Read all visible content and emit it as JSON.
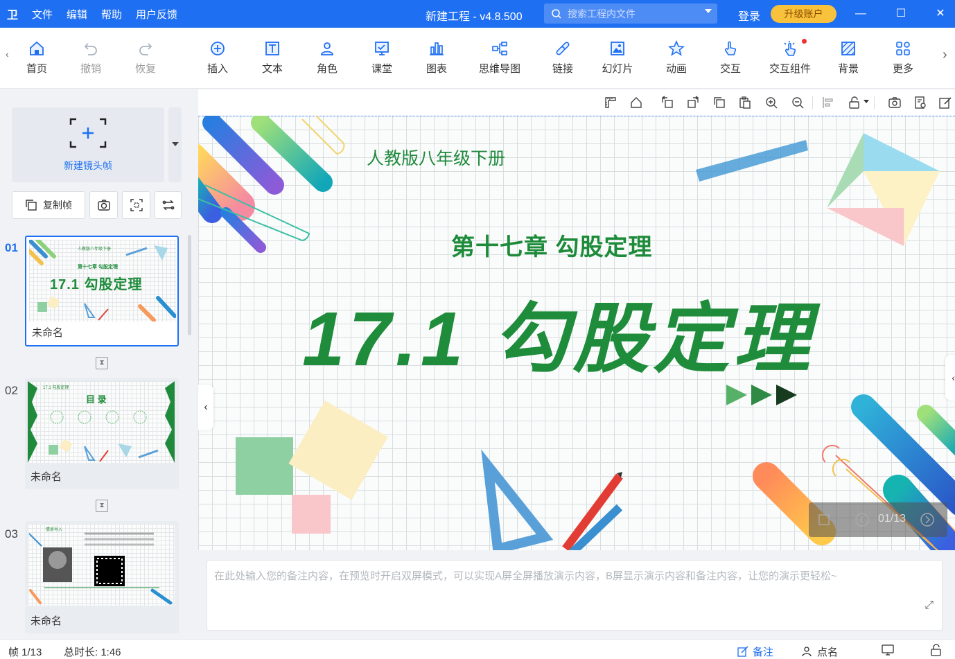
{
  "titlebar": {
    "logo": "卫",
    "menu": [
      "文件",
      "编辑",
      "帮助",
      "用户反馈"
    ],
    "window_title": "新建工程 - v4.8.500",
    "search_placeholder": "搜索工程内文件",
    "login": "登录",
    "upgrade": "升级账户",
    "minimize": "—",
    "maximize": "☐",
    "close": "✕"
  },
  "toolbar": {
    "left_arrow": "‹",
    "right_arrow": "›",
    "items": [
      {
        "label": "首页",
        "icon": "home-icon"
      },
      {
        "label": "撤销",
        "icon": "undo-icon"
      },
      {
        "label": "恢复",
        "icon": "redo-icon"
      },
      {
        "label": "插入",
        "icon": "plus-circle-icon"
      },
      {
        "label": "文本",
        "icon": "text-icon"
      },
      {
        "label": "角色",
        "icon": "person-icon"
      },
      {
        "label": "课堂",
        "icon": "classroom-icon"
      },
      {
        "label": "图表",
        "icon": "chart-icon"
      },
      {
        "label": "思维导图",
        "icon": "mindmap-icon"
      },
      {
        "label": "链接",
        "icon": "link-icon"
      },
      {
        "label": "幻灯片",
        "icon": "slide-icon"
      },
      {
        "label": "动画",
        "icon": "star-icon"
      },
      {
        "label": "交互",
        "icon": "hand-icon"
      },
      {
        "label": "交互组件",
        "icon": "interact-component-icon"
      },
      {
        "label": "背景",
        "icon": "background-icon"
      },
      {
        "label": "更多",
        "icon": "grid-icon"
      }
    ]
  },
  "leftpanel": {
    "new_frame_label": "新建镜头帧",
    "copy_frame_label": "复制帧",
    "frames": [
      {
        "num": "01",
        "name": "未命名",
        "mini_title": "17.1 勾股定理",
        "mini_sub": "第十七章 勾股定理",
        "mini_top": "人教版八年级下册"
      },
      {
        "num": "02",
        "name": "未命名",
        "mini_title": "目 录",
        "mini_top": "17.1 勾股定理"
      },
      {
        "num": "03",
        "name": "未命名",
        "mini_top": "情景导入"
      }
    ]
  },
  "slide": {
    "subtitle": "人教版八年级下册",
    "chapter": "第十七章 勾股定理",
    "title": "17.1  勾股定理",
    "page_indicator": "01/13"
  },
  "notes": {
    "placeholder": "在此处输入您的备注内容，在预览时开启双屏模式，可以实现A屏全屏播放演示内容，B屏显示演示内容和备注内容，让您的演示更轻松~",
    "expand": "⤢"
  },
  "statusbar": {
    "frame": "帧 1/13",
    "duration": "总时长: 1:46",
    "notes_btn": "备注",
    "rollcall_btn": "点名"
  },
  "colors": {
    "brand": "#1f6ff2",
    "title_green": "#1e8c3a",
    "upgrade": "#f9c23c"
  }
}
